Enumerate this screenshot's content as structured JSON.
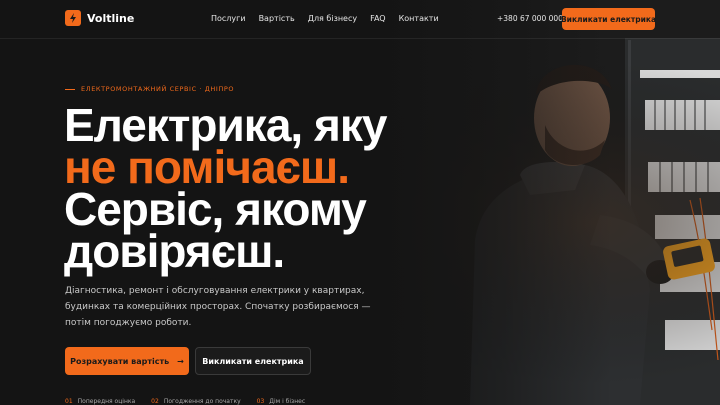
{
  "brand": {
    "name": "Voltline",
    "icon": "lightning-bolt-icon",
    "accent": "#f26a1b"
  },
  "nav": {
    "items": [
      "Послуги",
      "Вартість",
      "Для бізнесу",
      "FAQ",
      "Контакти"
    ],
    "phone": "+380 67 000 0000",
    "cta_label": "Викликати електрика"
  },
  "hero": {
    "eyebrow": "ЕЛЕКТРОМОНТАЖНИЙ СЕРВІС · ДНІПРО",
    "headline_line1": "Електрика, яку",
    "headline_line2_accent": "не помічаєш.",
    "headline_line3": "Сервіс, якому",
    "headline_line4": "довіряєш.",
    "lead": "Діагностика, ремонт і обслуговування електрики у квартирах, будинках та комерційних просторах. Спочатку розбираємося — потім погоджуємо роботи.",
    "primary_label": "Розрахувати вартість",
    "primary_arrow": "→",
    "secondary_label": "Викликати електрика",
    "steps": [
      {
        "num": "01",
        "text": "Попередня оцінка"
      },
      {
        "num": "02",
        "text": "Погодження до початку"
      },
      {
        "num": "03",
        "text": "Дім і бізнес"
      }
    ]
  },
  "photo": {
    "subject": "electrician-with-multimeter-at-panel",
    "icon": "technician-photo"
  }
}
